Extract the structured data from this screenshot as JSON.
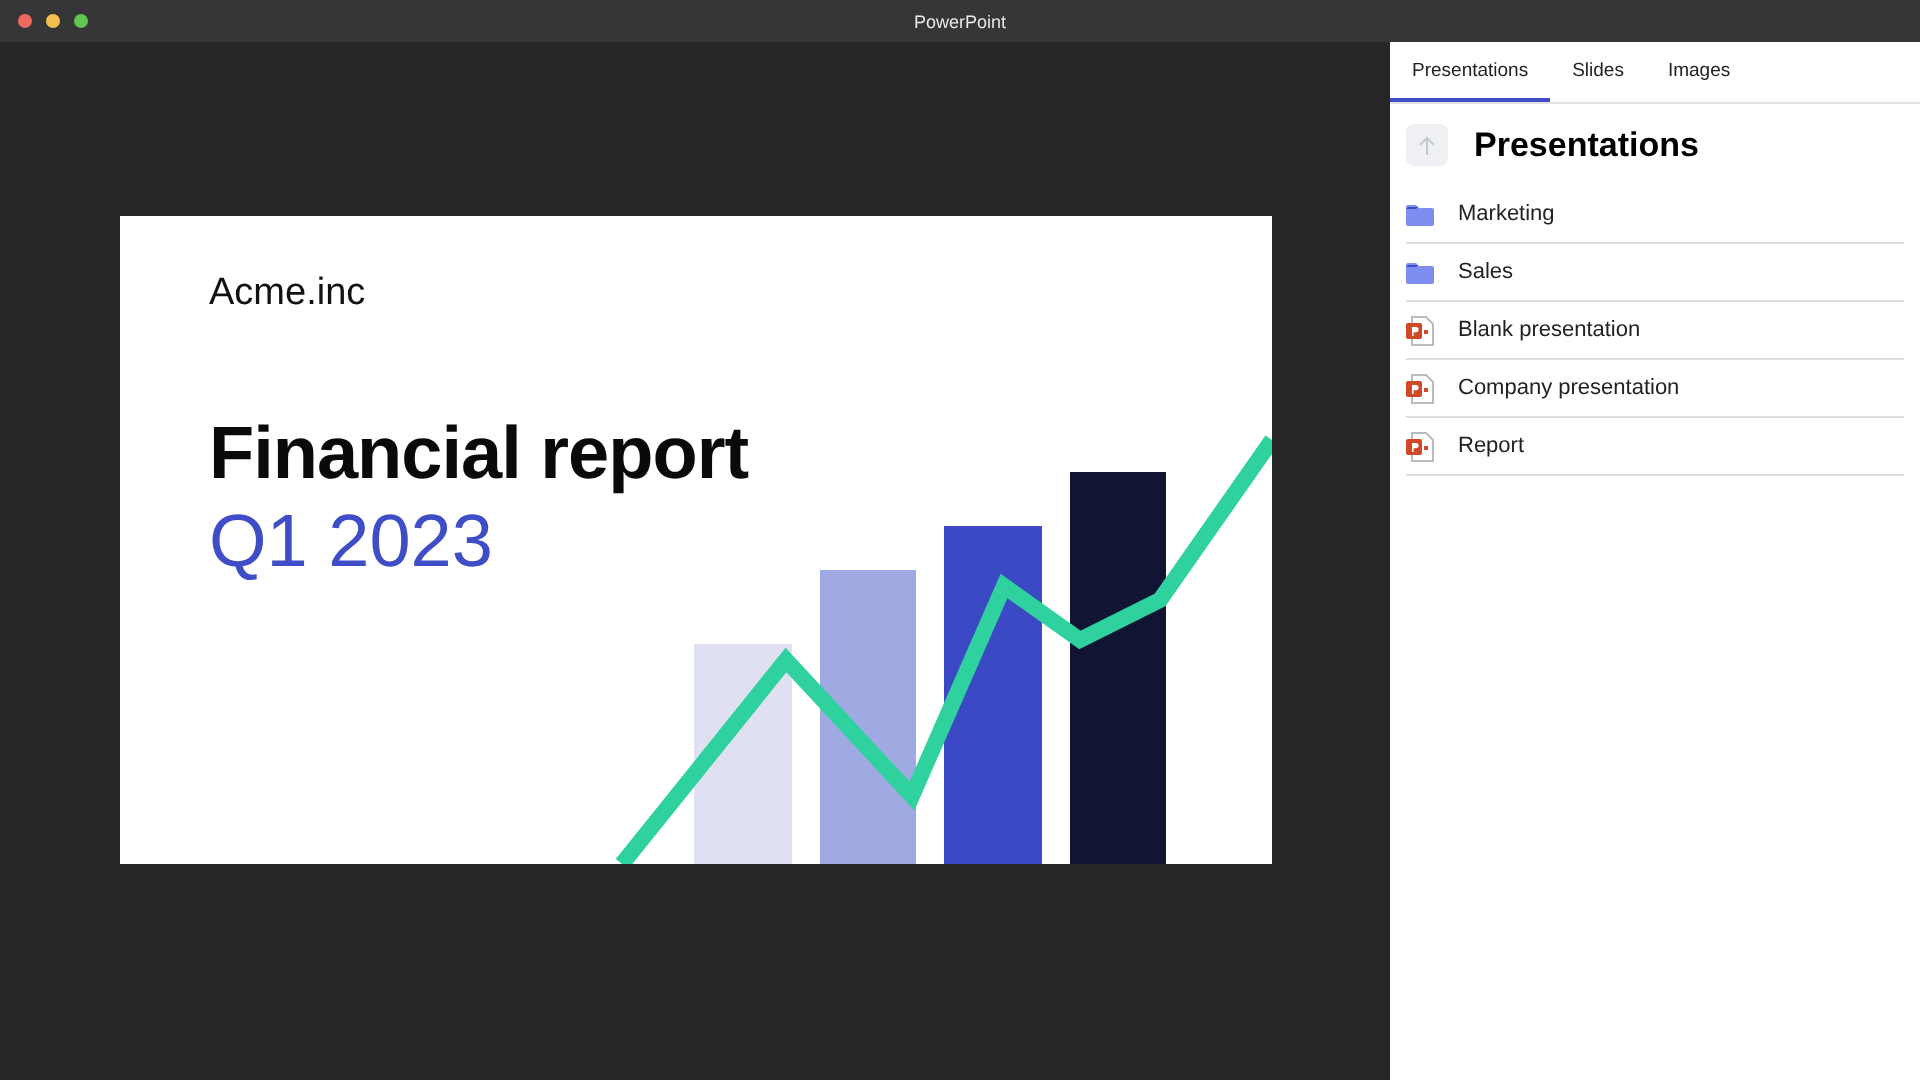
{
  "window": {
    "title": "PowerPoint"
  },
  "slide": {
    "brand": "Acme.inc",
    "title": "Financial report",
    "subtitle": "Q1 2023"
  },
  "panel": {
    "tabs": [
      {
        "label": "Presentations",
        "selected": true
      },
      {
        "label": "Slides",
        "selected": false
      },
      {
        "label": "Images",
        "selected": false
      }
    ],
    "heading": "Presentations",
    "items": [
      {
        "kind": "folder",
        "label": "Marketing"
      },
      {
        "kind": "folder",
        "label": "Sales"
      },
      {
        "kind": "presentation",
        "label": "Blank presentation"
      },
      {
        "kind": "presentation",
        "label": "Company presentation"
      },
      {
        "kind": "presentation",
        "label": "Report"
      }
    ]
  }
}
